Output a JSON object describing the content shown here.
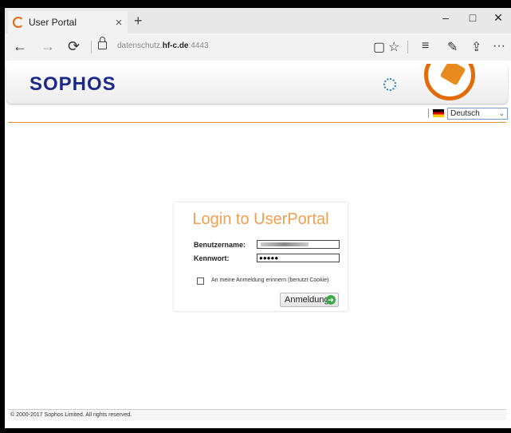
{
  "browser": {
    "tab_title": "User Portal",
    "tab_close": "×",
    "new_tab": "+",
    "url_prefix": "datenschutz.",
    "url_domain": "hf-c.de",
    "url_suffix": ":4443",
    "minimize": "–",
    "maximize": "□",
    "close": "✕",
    "back": "←",
    "forward": "→",
    "refresh": "⟳",
    "reading_view": "▢",
    "favorite": "☆",
    "hub": "≡",
    "notes": "✎",
    "share": "⇪",
    "more": "···"
  },
  "header": {
    "logo": "SOPHOS"
  },
  "language": {
    "selected": "Deutsch",
    "chevron": "⌄"
  },
  "login": {
    "title": "Login to UserPortal",
    "username_label": "Benutzername:",
    "password_label": "Kennwort:",
    "password_value": "●●●●●",
    "remember_label": "An meine Anmeldung erinnern (benutzt Cookie)",
    "submit_label": "Anmeldung",
    "submit_icon": "➜"
  },
  "footer": {
    "copyright": "© 2000-2017 Sophos Limited. All rights reserved."
  },
  "colors": {
    "accent_orange": "#e36b09",
    "brand_blue": "#1b2a8a",
    "go_green": "#3aa84a"
  }
}
